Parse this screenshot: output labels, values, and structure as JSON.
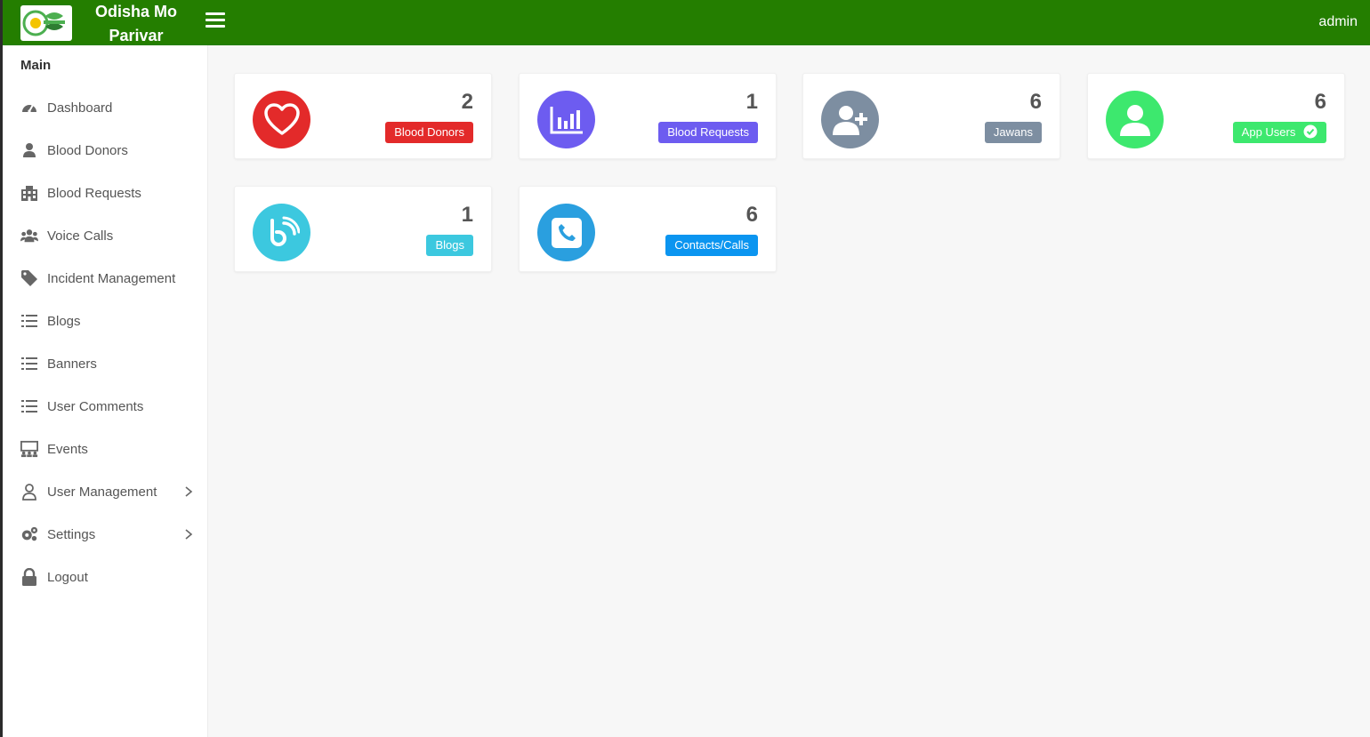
{
  "app": {
    "brand_line1": "Odisha Mo",
    "brand_line2": "Parivar",
    "user": "admin"
  },
  "sidebar": {
    "header": "Main",
    "items": [
      {
        "label": "Dashboard",
        "icon": "dashboard-icon"
      },
      {
        "label": "Blood Donors",
        "icon": "user-icon"
      },
      {
        "label": "Blood Requests",
        "icon": "building-icon"
      },
      {
        "label": "Voice Calls",
        "icon": "users-group-icon"
      },
      {
        "label": "Incident Management",
        "icon": "tag-icon"
      },
      {
        "label": "Blogs",
        "icon": "list-icon"
      },
      {
        "label": "Banners",
        "icon": "list-icon"
      },
      {
        "label": "User Comments",
        "icon": "list-icon"
      },
      {
        "label": "Events",
        "icon": "presentation-icon"
      },
      {
        "label": "User Management",
        "icon": "user-outline-icon",
        "has_submenu": true
      },
      {
        "label": "Settings",
        "icon": "gears-icon",
        "has_submenu": true
      },
      {
        "label": "Logout",
        "icon": "lock-icon"
      }
    ]
  },
  "cards": [
    {
      "count": "2",
      "label": "Blood Donors",
      "color": "#e32a2a",
      "badge_color": "#e32a2a",
      "icon": "heart-icon"
    },
    {
      "count": "1",
      "label": "Blood Requests",
      "color": "#6d5cf0",
      "badge_color": "#6d5cf0",
      "icon": "bar-chart-icon"
    },
    {
      "count": "6",
      "label": "Jawans",
      "color": "#7d8ea1",
      "badge_color": "#7d8ea1",
      "icon": "user-plus-icon"
    },
    {
      "count": "6",
      "label": "App Users",
      "color": "#3de86e",
      "badge_color": "#3de86e",
      "icon": "user-circle-icon",
      "badge_icon": "check-circle-icon"
    },
    {
      "count": "1",
      "label": "Blogs",
      "color": "#3cc8df",
      "badge_color": "#3cc8df",
      "icon": "blog-icon"
    },
    {
      "count": "6",
      "label": "Contacts/Calls",
      "color": "#2a9fdf",
      "badge_color": "#0b95f0",
      "icon": "phone-square-icon"
    }
  ]
}
